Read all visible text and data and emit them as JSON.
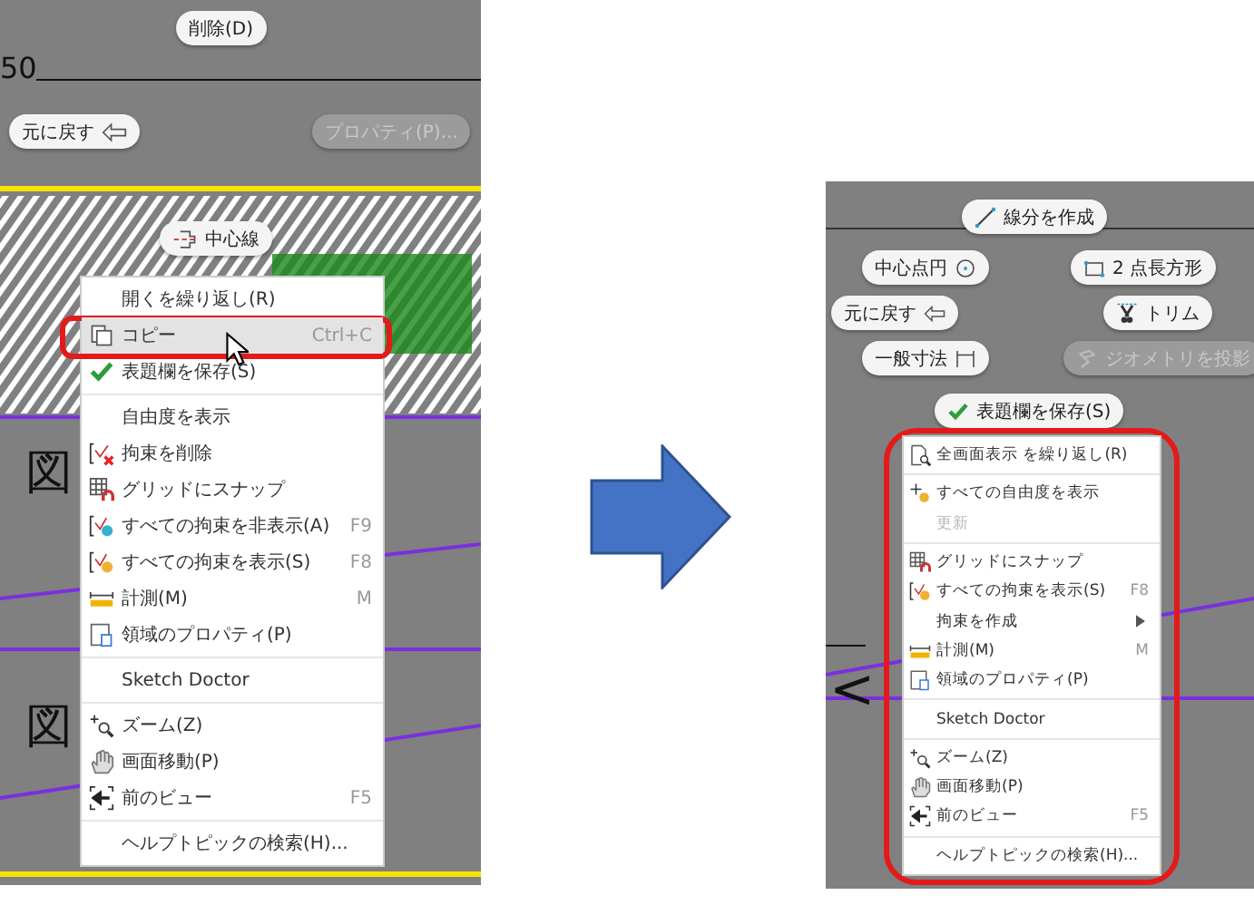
{
  "left": {
    "marking_buttons": [
      {
        "label": "削除(D)"
      },
      {
        "label": "元に戻す"
      },
      {
        "label": "プロパティ(P)...",
        "disabled": true
      },
      {
        "label": "中心線"
      }
    ],
    "canvas_texts": [
      "50",
      "図",
      "図"
    ],
    "menu": {
      "items": [
        {
          "kind": "item",
          "label": "開くを繰り返し(R)",
          "selected": false
        },
        {
          "kind": "item",
          "label": "コピー",
          "shortcut": "Ctrl+C",
          "selected": true,
          "highlighted": true
        },
        {
          "kind": "item",
          "label": "表題欄を保存(S)",
          "selected": false
        },
        {
          "kind": "separator"
        },
        {
          "kind": "item",
          "label": "自由度を表示",
          "selected": false
        },
        {
          "kind": "item",
          "label": "拘束を削除",
          "selected": false
        },
        {
          "kind": "item",
          "label": "グリッドにスナップ",
          "selected": false
        },
        {
          "kind": "item",
          "label": "すべての拘束を非表示(A)",
          "shortcut": "F9",
          "selected": false
        },
        {
          "kind": "item",
          "label": "すべての拘束を表示(S)",
          "shortcut": "F8",
          "selected": false
        },
        {
          "kind": "item",
          "label": "計測(M)",
          "shortcut": "M",
          "selected": false
        },
        {
          "kind": "item",
          "label": "領域のプロパティ(P)",
          "selected": false
        },
        {
          "kind": "separator"
        },
        {
          "kind": "item",
          "label": "Sketch Doctor",
          "selected": false
        },
        {
          "kind": "separator"
        },
        {
          "kind": "item",
          "label": "ズーム(Z)",
          "selected": false
        },
        {
          "kind": "item",
          "label": "画面移動(P)",
          "selected": false
        },
        {
          "kind": "item",
          "label": "前のビュー",
          "shortcut": "F5",
          "selected": false
        },
        {
          "kind": "separator"
        },
        {
          "kind": "item",
          "label": "ヘルプトピックの検索(H)...",
          "selected": false
        }
      ]
    }
  },
  "right": {
    "marking_buttons": [
      {
        "label": "線分を作成"
      },
      {
        "label": "中心点円"
      },
      {
        "label": "2 点長方形"
      },
      {
        "label": "元に戻す"
      },
      {
        "label": "トリム"
      },
      {
        "label": "一般寸法"
      },
      {
        "label": "ジオメトリを投影",
        "disabled": true
      },
      {
        "label": "表題欄を保存(S)"
      }
    ],
    "canvas_texts": [
      "<"
    ],
    "menu": {
      "circled": true,
      "items": [
        {
          "kind": "item",
          "label": "全画面表示 を繰り返し(R)",
          "selected": false
        },
        {
          "kind": "separator"
        },
        {
          "kind": "item",
          "label": "すべての自由度を表示",
          "selected": false
        },
        {
          "kind": "item",
          "label": "更新",
          "selected": false,
          "disabled": true
        },
        {
          "kind": "separator"
        },
        {
          "kind": "item",
          "label": "グリッドにスナップ",
          "selected": false
        },
        {
          "kind": "item",
          "label": "すべての拘束を表示(S)",
          "shortcut": "F8",
          "selected": false
        },
        {
          "kind": "item",
          "label": "拘束を作成",
          "selected": false,
          "submenu": true
        },
        {
          "kind": "item",
          "label": "計測(M)",
          "shortcut": "M",
          "selected": false
        },
        {
          "kind": "item",
          "label": "領域のプロパティ(P)",
          "selected": false
        },
        {
          "kind": "separator"
        },
        {
          "kind": "item",
          "label": "Sketch Doctor",
          "selected": false
        },
        {
          "kind": "separator"
        },
        {
          "kind": "item",
          "label": "ズーム(Z)",
          "selected": false
        },
        {
          "kind": "item",
          "label": "画面移動(P)",
          "selected": false
        },
        {
          "kind": "item",
          "label": "前のビュー",
          "shortcut": "F5",
          "selected": false
        },
        {
          "kind": "separator"
        },
        {
          "kind": "item",
          "label": "ヘルプトピックの検索(H)...",
          "selected": false
        }
      ]
    }
  }
}
